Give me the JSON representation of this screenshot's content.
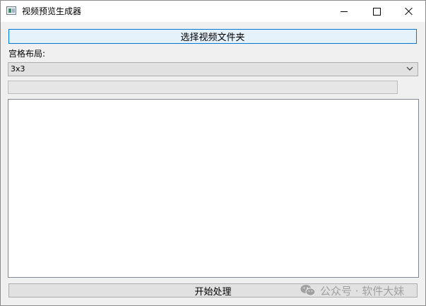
{
  "window": {
    "title": "视频预览生成器",
    "icon": "app-icon",
    "controls": [
      "minimize-icon",
      "maximize-icon",
      "close-icon"
    ]
  },
  "main": {
    "select_folder_label": "选择视频文件夹",
    "grid_layout_label": "宫格布局:",
    "grid_layout_value": "3x3",
    "progress": 0,
    "log_text": "",
    "start_label": "开始处理"
  },
  "watermark": {
    "icon": "wechat-icon",
    "text": "公众号 · 软件大妹"
  },
  "colors": {
    "focus_border": "#0078d7",
    "focus_bg": "#e5f1fb",
    "button_bg": "#e1e1e1",
    "window_bg": "#f0f0f0"
  }
}
